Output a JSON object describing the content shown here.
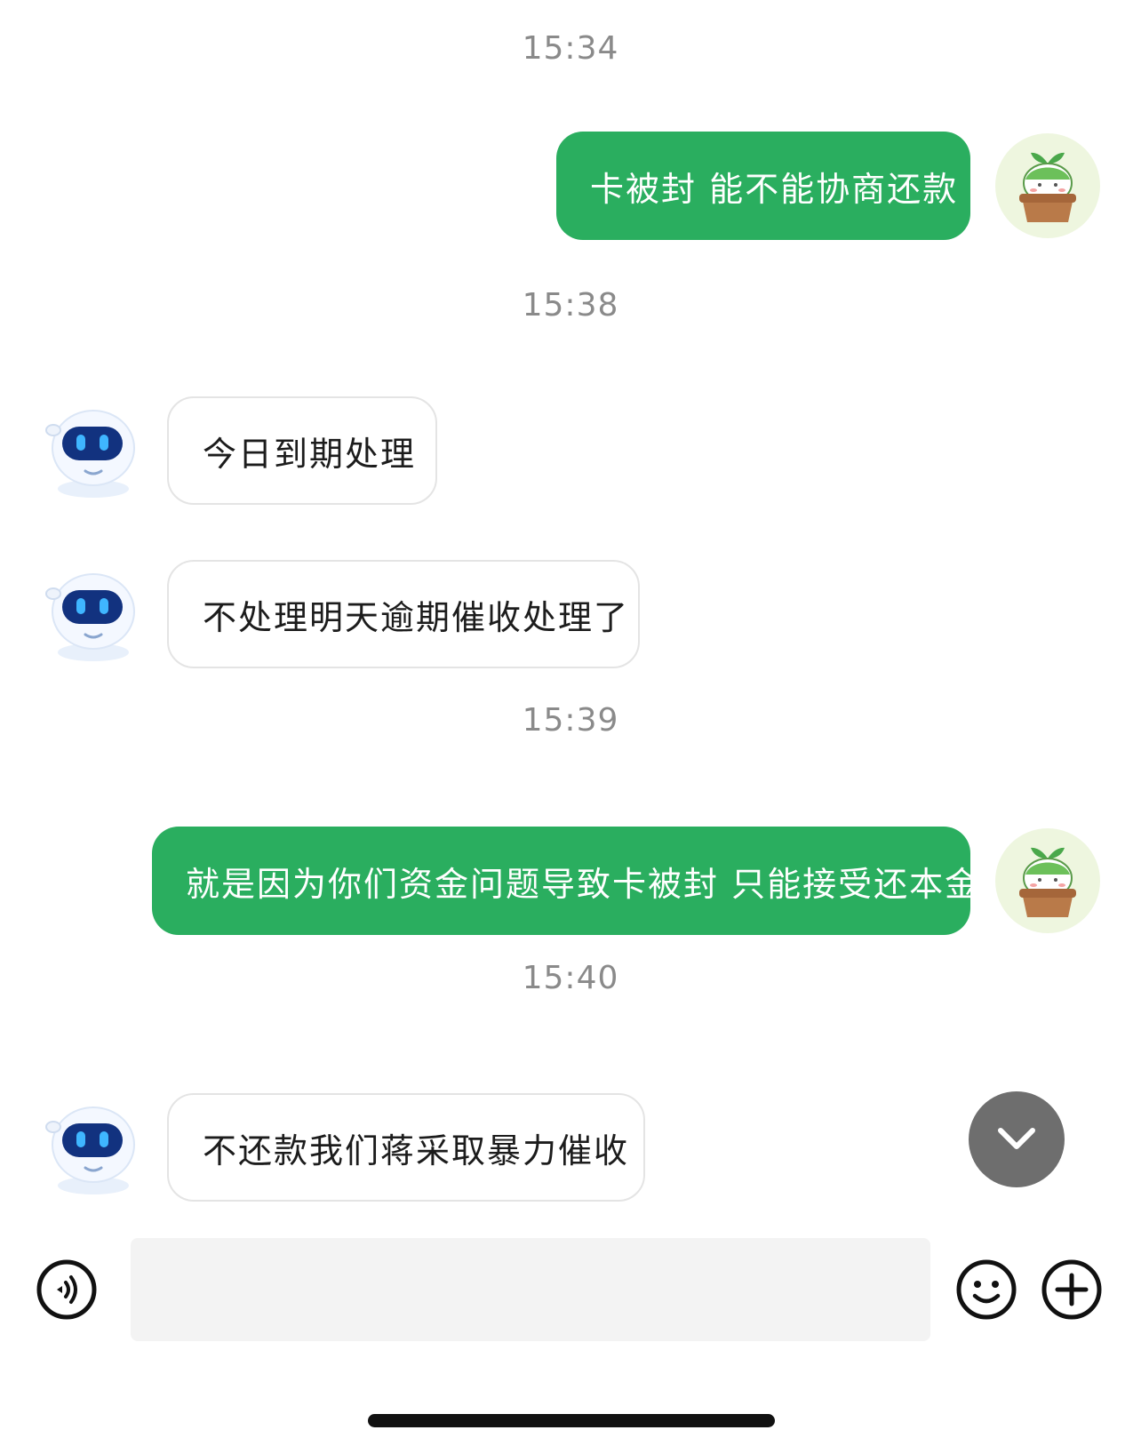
{
  "messages": [
    {
      "kind": "time",
      "text": "15:34"
    },
    {
      "kind": "out",
      "text": "卡被封 能不能协商还款",
      "avatar": "sprout-cat-avatar"
    },
    {
      "kind": "time",
      "text": "15:38"
    },
    {
      "kind": "in",
      "text": "今日到期处理",
      "avatar": "robot-avatar"
    },
    {
      "kind": "in",
      "text": "不处理明天逾期催收处理了",
      "avatar": "robot-avatar"
    },
    {
      "kind": "time",
      "text": "15:39"
    },
    {
      "kind": "out",
      "text": "就是因为你们资金问题导致卡被封 只能接受还本金",
      "avatar": "sprout-cat-avatar"
    },
    {
      "kind": "time",
      "text": "15:40"
    },
    {
      "kind": "in",
      "text": "不还款我们蒋采取暴力催收",
      "avatar": "robot-avatar"
    }
  ],
  "composer": {
    "voice_icon": "voice-icon",
    "input_value": "",
    "emoji_icon": "emoji-icon",
    "plus_icon": "plus-icon"
  },
  "scroll_down_icon": "chevron-down-icon",
  "colors": {
    "outgoing_bubble": "#2aae5f",
    "incoming_border": "#e4e4e4",
    "timestamp": "#8a8a8a",
    "scroll_button": "#6e6e6e"
  }
}
